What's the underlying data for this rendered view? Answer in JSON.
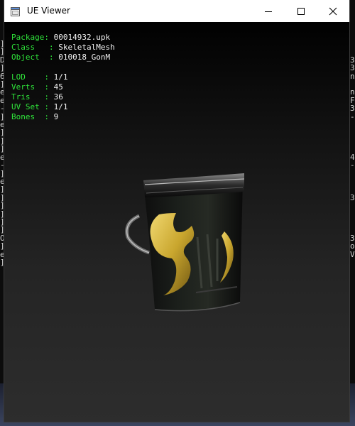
{
  "window": {
    "title": "UE Viewer",
    "icon": "app-window-icon",
    "buttons": [
      "minimize-icon",
      "maximize-icon",
      "close-icon"
    ]
  },
  "info": {
    "package_label": "Package",
    "package": "00014932.upk",
    "class_label": "Class",
    "class": "SkeletalMesh",
    "object_label": "Object",
    "object": "010018_GonM",
    "lod_label": "LOD",
    "lod": "1/1",
    "verts_label": "Verts",
    "verts": "45",
    "tris_label": "Tris",
    "tris": "36",
    "uvset_label": "UV Set",
    "uvset": "1/1",
    "bones_label": "Bones",
    "bones": "9"
  },
  "colors": {
    "label": "#2fe43a",
    "value": "#f2f2f2",
    "viewport_top": "#010101",
    "viewport_bottom": "#2d2d2d",
    "gold": "#c9a62e"
  }
}
